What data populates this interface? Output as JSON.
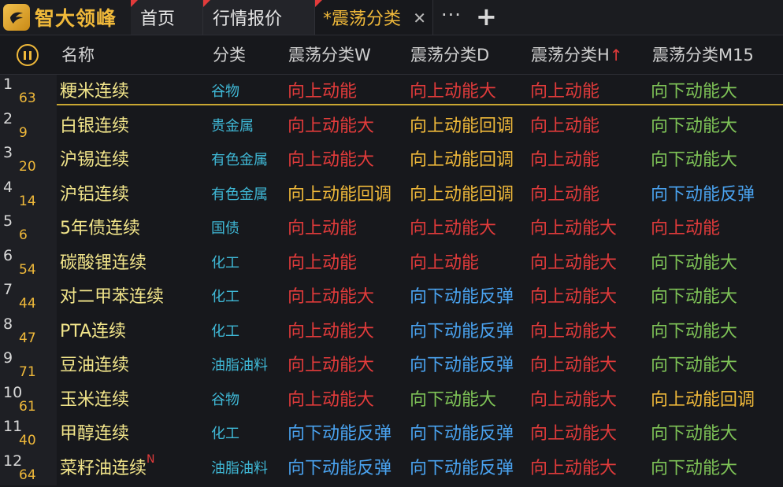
{
  "app": {
    "logo_text": "智大领峰",
    "tabs": [
      {
        "label": "首页"
      },
      {
        "label": "行情报价"
      },
      {
        "label": "*震荡分类"
      }
    ],
    "close_glyph": "✕",
    "more_glyph": "···",
    "plus_glyph": "+"
  },
  "header": {
    "name": "名称",
    "category": "分类",
    "w": "震荡分类W",
    "d": "震荡分类D",
    "h": "震荡分类H",
    "h_sort": "↑",
    "m15": "震荡分类M15"
  },
  "colors": {
    "up": "#e23b3b",
    "up_pullback": "#f0b93a",
    "down_big": "#7fc457",
    "down_rebound": "#4aa3f0"
  },
  "rows": [
    {
      "idx": "1",
      "sub": "63",
      "name": "粳米连续",
      "badge": "",
      "cat": "谷物",
      "w": "向上动能",
      "d": "向上动能大",
      "h": "向上动能",
      "m": "向下动能大"
    },
    {
      "idx": "2",
      "sub": "9",
      "name": "白银连续",
      "badge": "",
      "cat": "贵金属",
      "w": "向上动能大",
      "d": "向上动能回调",
      "h": "向上动能",
      "m": "向下动能大"
    },
    {
      "idx": "3",
      "sub": "20",
      "name": "沪锡连续",
      "badge": "",
      "cat": "有色金属",
      "w": "向上动能大",
      "d": "向上动能回调",
      "h": "向上动能",
      "m": "向下动能大"
    },
    {
      "idx": "4",
      "sub": "14",
      "name": "沪铝连续",
      "badge": "",
      "cat": "有色金属",
      "w": "向上动能回调",
      "d": "向上动能回调",
      "h": "向上动能",
      "m": "向下动能反弹"
    },
    {
      "idx": "5",
      "sub": "6",
      "name": "5年债连续",
      "badge": "",
      "cat": "国债",
      "w": "向上动能",
      "d": "向上动能大",
      "h": "向上动能大",
      "m": "向上动能"
    },
    {
      "idx": "6",
      "sub": "54",
      "name": "碳酸锂连续",
      "badge": "",
      "cat": "化工",
      "w": "向上动能",
      "d": "向上动能",
      "h": "向上动能大",
      "m": "向下动能大"
    },
    {
      "idx": "7",
      "sub": "44",
      "name": "对二甲苯连续",
      "badge": "",
      "cat": "化工",
      "w": "向上动能大",
      "d": "向下动能反弹",
      "h": "向上动能大",
      "m": "向下动能大"
    },
    {
      "idx": "8",
      "sub": "47",
      "name": "PTA连续",
      "badge": "",
      "cat": "化工",
      "w": "向上动能大",
      "d": "向下动能反弹",
      "h": "向上动能大",
      "m": "向下动能大"
    },
    {
      "idx": "9",
      "sub": "71",
      "name": "豆油连续",
      "badge": "",
      "cat": "油脂油料",
      "w": "向上动能大",
      "d": "向下动能反弹",
      "h": "向上动能大",
      "m": "向下动能大"
    },
    {
      "idx": "10",
      "sub": "61",
      "name": "玉米连续",
      "badge": "",
      "cat": "谷物",
      "w": "向上动能大",
      "d": "向下动能大",
      "h": "向上动能大",
      "m": "向上动能回调"
    },
    {
      "idx": "11",
      "sub": "40",
      "name": "甲醇连续",
      "badge": "",
      "cat": "化工",
      "w": "向下动能反弹",
      "d": "向下动能反弹",
      "h": "向上动能大",
      "m": "向下动能大"
    },
    {
      "idx": "12",
      "sub": "64",
      "name": "菜籽油连续",
      "badge": "N",
      "cat": "油脂油料",
      "w": "向下动能反弹",
      "d": "向下动能反弹",
      "h": "向上动能大",
      "m": "向下动能大"
    }
  ]
}
